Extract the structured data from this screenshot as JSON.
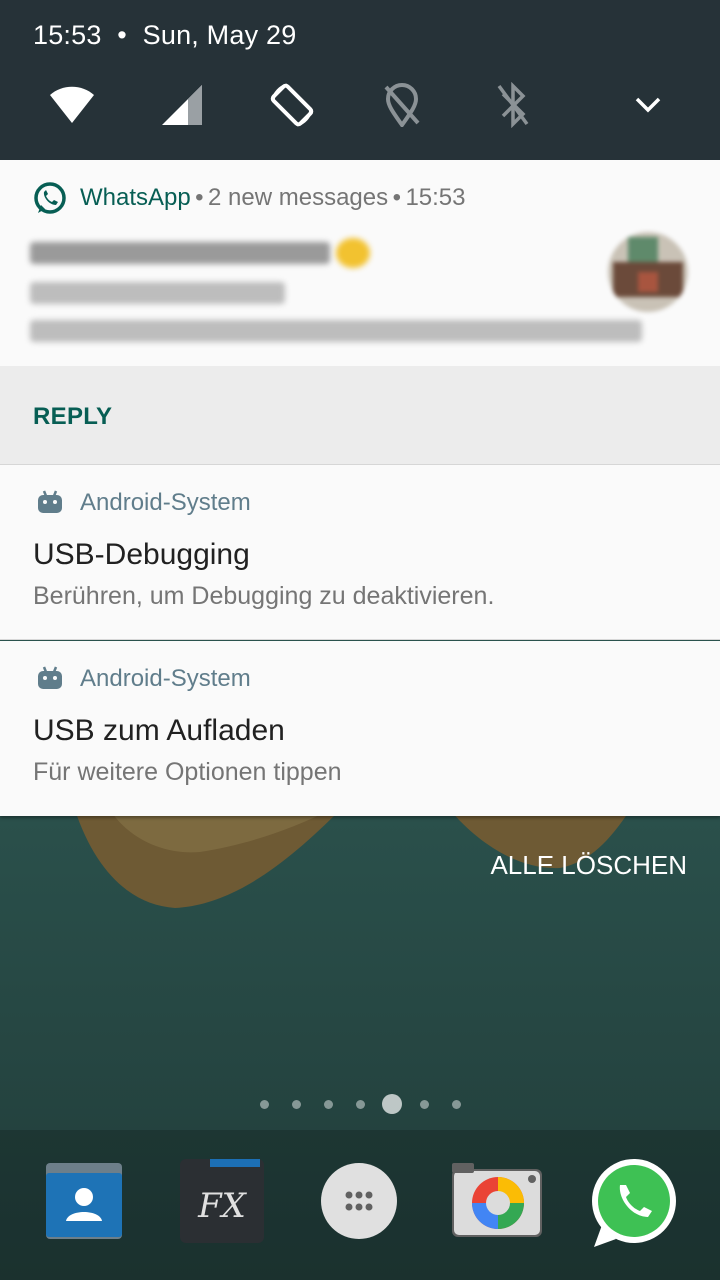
{
  "status_bar": {
    "time": "15:53",
    "separator": "•",
    "date": "Sun, May 29"
  },
  "quick_settings": {
    "tiles": [
      "wifi-icon",
      "cellular-signal-icon",
      "auto-rotate-icon",
      "location-off-icon",
      "bluetooth-off-icon"
    ],
    "expand_icon": "chevron-down-icon"
  },
  "whatsapp_notification": {
    "app_name": "WhatsApp",
    "dot1": "•",
    "summary": "2 new messages",
    "dot2": "•",
    "time": "15:53",
    "reply_label": "REPLY",
    "brand_color": "#075e54"
  },
  "notifications": [
    {
      "app": "Android-System",
      "title": "USB-Debugging",
      "text": "Berühren, um Debugging zu deaktivieren."
    },
    {
      "app": "Android-System",
      "title": "USB zum Aufladen",
      "text": "Für weitere Optionen tippen"
    }
  ],
  "clear_all_label": "ALLE LÖSCHEN",
  "home": {
    "page_count": 7,
    "current_page": 5,
    "dock": [
      "contacts-app-icon",
      "fx-file-explorer-icon",
      "app-drawer-icon",
      "camera-app-icon",
      "whatsapp-app-icon"
    ]
  }
}
